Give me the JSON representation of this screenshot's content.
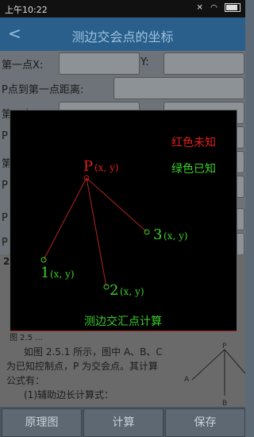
{
  "status": {
    "time": "上午10:22"
  },
  "header": {
    "title": "测边交会点的坐标"
  },
  "form": {
    "point1_x_label": "第一点X:",
    "point1_y_label": "Y:",
    "dist1_label": "P点到第一点距离:",
    "point2_x_label": "第二点X",
    "row_p1": "P",
    "row_p2": "P",
    "row_di": "第",
    "row_p3": "P",
    "row_p4": "P",
    "row_p5": "P"
  },
  "doc": {
    "formula_no": "2",
    "figure_caption": "图 2.5  ...",
    "line1": "如图 2.5.1 所示，图中 A、B、C",
    "line2": "为已知控制点，P 为交会点。其计算",
    "line3": "公式有：",
    "line4": "(1)辅助边长计算式：",
    "fig_p": "P",
    "fig_a": "A",
    "fig_b": "B"
  },
  "dialog": {
    "legend_red": "红色未知",
    "legend_green": "绿色已知",
    "p_label": "P",
    "p_coords": "(x, y)",
    "pt1_label": "1",
    "pt1_coords": "(x, y)",
    "pt2_label": "2",
    "pt2_coords": "(x, y)",
    "pt3_label": "3",
    "pt3_coords": "(x, y)",
    "caption": "测边交汇点计算",
    "colors": {
      "unknown": "#e0201c",
      "known": "#3ccf2a",
      "line": "#b5241c"
    }
  },
  "bottom": {
    "diagram_btn": "原理图",
    "calc_btn": "计算",
    "save_btn": "保存"
  }
}
